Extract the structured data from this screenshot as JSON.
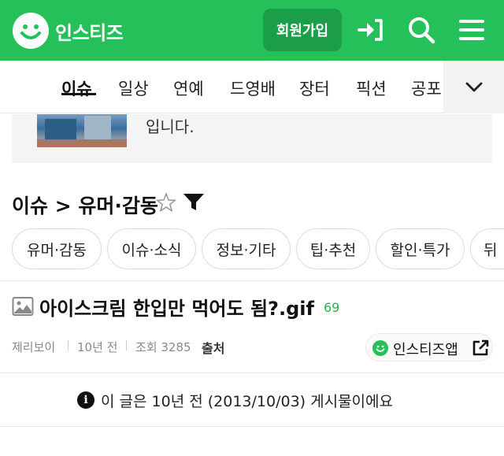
{
  "header": {
    "brand": "인스티즈",
    "join_label": "회원가입",
    "icons": [
      "login-icon",
      "search-icon",
      "menu-icon"
    ],
    "color": "#26c05a"
  },
  "tabs": [
    {
      "label": "이슈",
      "active": true
    },
    {
      "label": "일상"
    },
    {
      "label": "연예"
    },
    {
      "label": "드영배"
    },
    {
      "label": "장터"
    },
    {
      "label": "픽션"
    },
    {
      "label": "공포"
    }
  ],
  "notice": {
    "text": "입니다."
  },
  "category": {
    "title": "이슈 > 유머·감동"
  },
  "chips": [
    "유머·감동",
    "이슈·소식",
    "정보·기타",
    "팁·추천",
    "할인·특가",
    "뒤"
  ],
  "post": {
    "title": "아이스크림 한입만 먹어도 됨?.gif",
    "comments": "69",
    "author": "제리보이",
    "time": "10년 전",
    "views": "조회 3285",
    "source": "출처",
    "app_label": "인스티즈앱",
    "info": "이 글은 10년 전 (2013/10/03) 게시물이에요"
  }
}
